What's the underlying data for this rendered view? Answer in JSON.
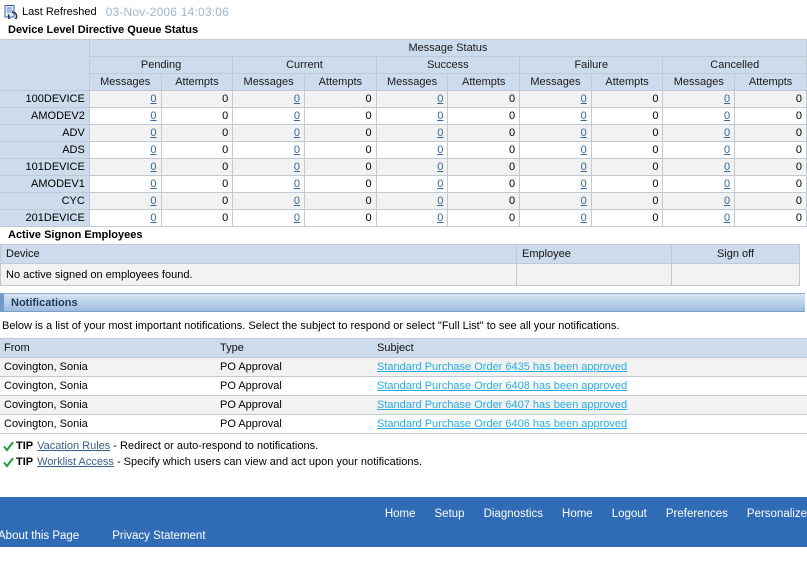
{
  "header": {
    "refresh_icon": "refresh-page-icon",
    "refresh_label": "Last Refreshed",
    "refresh_date": "03-Nov-2006 14:03:06"
  },
  "queue": {
    "title": "Device Level Directive Queue Status",
    "group_header": "Message Status",
    "status_groups": [
      "Pending",
      "Current",
      "Success",
      "Failure",
      "Cancelled"
    ],
    "sub_headers": [
      "Messages",
      "Attempts"
    ],
    "rows": [
      {
        "device": "100DEVICE",
        "values": [
          "0",
          "0",
          "0",
          "0",
          "0",
          "0",
          "0",
          "0",
          "0",
          "0"
        ]
      },
      {
        "device": "AMODEV2",
        "values": [
          "0",
          "0",
          "0",
          "0",
          "0",
          "0",
          "0",
          "0",
          "0",
          "0"
        ]
      },
      {
        "device": "ADV",
        "values": [
          "0",
          "0",
          "0",
          "0",
          "0",
          "0",
          "0",
          "0",
          "0",
          "0"
        ]
      },
      {
        "device": "ADS",
        "values": [
          "0",
          "0",
          "0",
          "0",
          "0",
          "0",
          "0",
          "0",
          "0",
          "0"
        ]
      },
      {
        "device": "101DEVICE",
        "values": [
          "0",
          "0",
          "0",
          "0",
          "0",
          "0",
          "0",
          "0",
          "0",
          "0"
        ]
      },
      {
        "device": "AMODEV1",
        "values": [
          "0",
          "0",
          "0",
          "0",
          "0",
          "0",
          "0",
          "0",
          "0",
          "0"
        ]
      },
      {
        "device": "CYC",
        "values": [
          "0",
          "0",
          "0",
          "0",
          "0",
          "0",
          "0",
          "0",
          "0",
          "0"
        ]
      },
      {
        "device": "201DEVICE",
        "values": [
          "0",
          "0",
          "0",
          "0",
          "0",
          "0",
          "0",
          "0",
          "0",
          "0"
        ]
      }
    ]
  },
  "signon": {
    "title": "Active Signon Employees",
    "columns": [
      "Device",
      "Employee",
      "Sign off"
    ],
    "empty_message": "No active signed on employees found."
  },
  "notifications": {
    "bar_title": "Notifications",
    "description": "Below is a list of your most important notifications. Select the subject to respond or select \"Full List\" to see all your notifications.",
    "columns": [
      "From",
      "Type",
      "Subject"
    ],
    "rows": [
      {
        "from": "Covington, Sonia",
        "type": "PO Approval",
        "subject": "Standard Purchase Order 6435 has been approved"
      },
      {
        "from": "Covington, Sonia",
        "type": "PO Approval",
        "subject": "Standard Purchase Order 6408 has been approved"
      },
      {
        "from": "Covington, Sonia",
        "type": "PO Approval",
        "subject": "Standard Purchase Order 6407 has been approved"
      },
      {
        "from": "Covington, Sonia",
        "type": "PO Approval",
        "subject": "Standard Purchase Order 6406 has been approved"
      }
    ]
  },
  "tips": [
    {
      "word": "TIP",
      "link": "Vacation Rules",
      "text": "- Redirect or auto-respond to notifications."
    },
    {
      "word": "TIP",
      "link": "Worklist Access",
      "text": "- Specify which users can view and act upon your notifications."
    }
  ],
  "footer": {
    "nav": [
      "Home",
      "Setup",
      "Diagnostics",
      "Home",
      "Logout",
      "Preferences",
      "Personalize"
    ],
    "about": "About this Page",
    "privacy": "Privacy Statement"
  },
  "colors": {
    "header_blue": "#cddcec",
    "footer_blue": "#2f6cb5",
    "link_blue": "#29abe2",
    "alt_row": "#f2f2f2"
  }
}
